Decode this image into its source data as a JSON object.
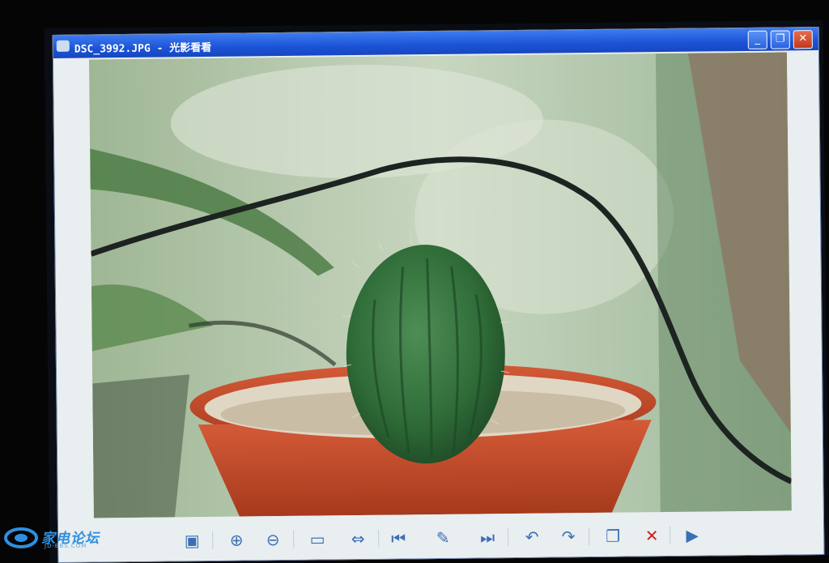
{
  "window": {
    "title": "DSC_3992.JPG - 光影看看",
    "controls": {
      "minimize": "_",
      "restore": "❐",
      "close": "✕"
    }
  },
  "photo": {
    "subject": "potted cactus"
  },
  "toolbar": {
    "items": [
      {
        "name": "display-mode-icon",
        "glyph": "▣"
      },
      {
        "name": "zoom-in-icon",
        "glyph": "⊕"
      },
      {
        "name": "zoom-out-icon",
        "glyph": "⊖"
      },
      {
        "name": "actual-size-icon",
        "glyph": "▭"
      },
      {
        "name": "fit-window-icon",
        "glyph": "⇔"
      },
      {
        "name": "previous-icon",
        "glyph": "⏮"
      },
      {
        "name": "edit-icon",
        "glyph": "✎"
      },
      {
        "name": "next-icon",
        "glyph": "⏭"
      },
      {
        "name": "rotate-left-icon",
        "glyph": "↶"
      },
      {
        "name": "rotate-right-icon",
        "glyph": "↷"
      },
      {
        "name": "copy-icon",
        "glyph": "❐"
      },
      {
        "name": "delete-icon",
        "glyph": "✕"
      },
      {
        "name": "slideshow-icon",
        "glyph": "▶"
      }
    ]
  },
  "watermark": {
    "text": "家电论坛",
    "sub": "JD-BBS.COM"
  },
  "colors": {
    "titlebar": "#1b53d6",
    "delete": "#d12020",
    "pot": "#c24a2a",
    "cactus": "#2e6b37"
  }
}
